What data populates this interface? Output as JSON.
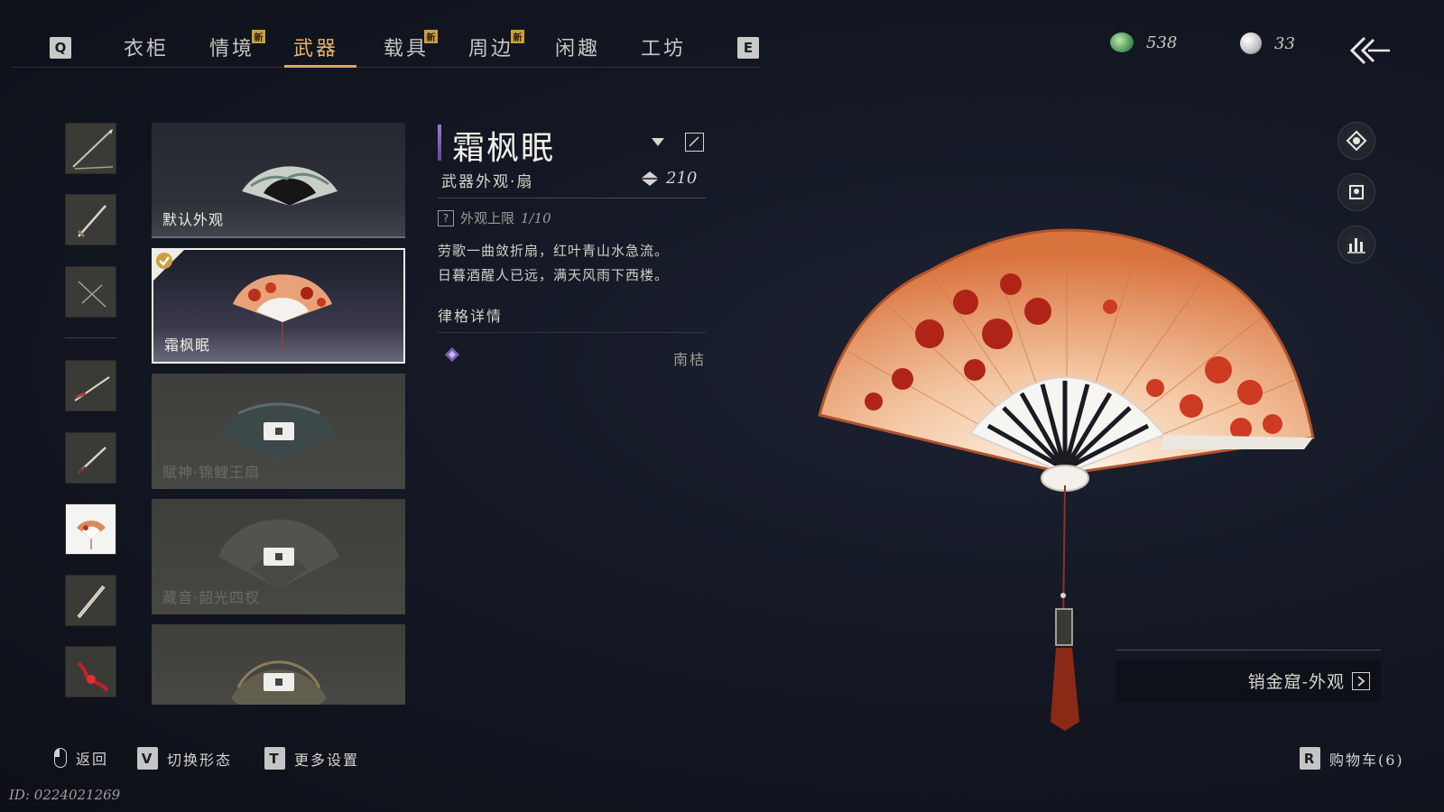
{
  "nav": {
    "left_key": "Q",
    "right_key": "E",
    "tabs": [
      {
        "label": "衣柜"
      },
      {
        "label": "情境",
        "badge": "新"
      },
      {
        "label": "武器"
      },
      {
        "label": "载具",
        "badge": "新"
      },
      {
        "label": "周边",
        "badge": "新"
      },
      {
        "label": "闲趣"
      },
      {
        "label": "工坊"
      }
    ],
    "active_tab": "武器"
  },
  "currency": [
    {
      "icon": "jade-coin-icon",
      "value": "538"
    },
    {
      "icon": "pearl-icon",
      "value": "33"
    }
  ],
  "categories": [
    {
      "icon": "spear-icon"
    },
    {
      "icon": "sword-icon"
    },
    {
      "icon": "twin-blades-icon"
    },
    {
      "icon": "long-blade-icon"
    },
    {
      "icon": "dagger-icon"
    },
    {
      "icon": "fan-icon",
      "selected": true
    },
    {
      "icon": "umbrella-icon"
    },
    {
      "icon": "red-rope-dart-icon"
    }
  ],
  "skins": [
    {
      "label": "默认外观",
      "state": "owned"
    },
    {
      "label": "霜枫眠",
      "state": "equipped"
    },
    {
      "label": "赋神·锦鲤王扇",
      "state": "locked"
    },
    {
      "label": "藏音·韶光四杈",
      "state": "locked"
    },
    {
      "label": "",
      "state": "locked"
    }
  ],
  "detail": {
    "title": "霜枫眠",
    "subtitle": "武器外观·扇",
    "score": "210",
    "limit_label": "外观上限",
    "limit_value": "1/10",
    "poem_line1": "劳歌一曲敛折扇，红叶青山水急流。",
    "poem_line2": "日暮酒醒人已远，满天风雨下西楼。",
    "section_title": "律格详情",
    "rule_name": "南桔"
  },
  "shop": {
    "label": "销金窟-外观"
  },
  "hints": [
    {
      "key": "mouse",
      "label": "返回"
    },
    {
      "key": "V",
      "label": "切换形态"
    },
    {
      "key": "T",
      "label": "更多设置"
    }
  ],
  "cart": {
    "key": "R",
    "label": "购物车(6)"
  },
  "player_id": "ID: 0224021269",
  "colors": {
    "accent": "#e5b46b",
    "title_bar": "#8a6fcc"
  }
}
